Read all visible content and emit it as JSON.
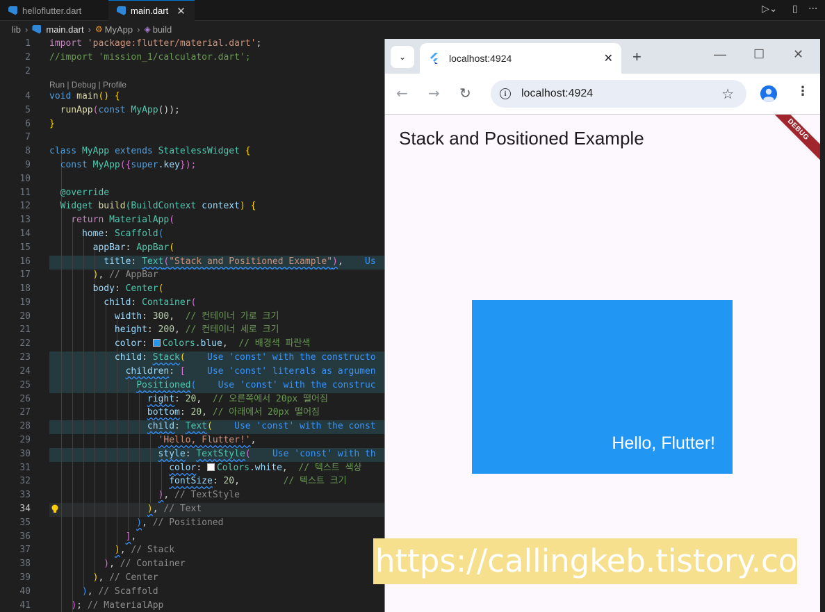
{
  "editor_tabs": [
    {
      "label": "helloflutter.dart",
      "active": false
    },
    {
      "label": "main.dart",
      "active": true
    }
  ],
  "breadcrumb": {
    "folder": "lib",
    "file": "main.dart",
    "class": "MyApp",
    "method": "build"
  },
  "codelens": "Run | Debug | Profile",
  "current_line": 34,
  "code": {
    "l1_kw": "import",
    "l1_str": "'package:flutter/material.dart'",
    "l1_end": ";",
    "l2": "//import 'mission_1/calculator.dart';",
    "l4_void": "void",
    "l4_main": "main",
    "l4_rest": "() {",
    "l5_fn": "runApp",
    "l5_const": "const",
    "l5_cls": "MyApp",
    "l5_rest": "());",
    "l6": "}",
    "l8_class": "class",
    "l8_name": "MyApp",
    "l8_ext": "extends",
    "l8_base": "StatelessWidget",
    "l8_brace": "{",
    "l9_const": "const",
    "l9_name": "MyApp",
    "l9_open": "({",
    "l9_super": "super",
    "l9_key": ".key",
    "l9_close": "});",
    "l11": "@override",
    "l12_type": "Widget",
    "l12_fn": "build",
    "l12_arg": "(BuildContext",
    "l12_ctx": "context",
    "l12_rest": ") {",
    "l13_ret": "return",
    "l13_cls": "MaterialApp",
    "l14_home": "home",
    "l14_cls": "Scaffold",
    "l15_prop": "appBar",
    "l15_cls": "AppBar",
    "l16_prop": "title",
    "l16_cls": "Text",
    "l16_str": "\"Stack and Positioned Example\"",
    "l16_hint": "Us",
    "l17_close": "),",
    "l17_cmt": "// AppBar",
    "l18_prop": "body",
    "l18_cls": "Center",
    "l19_prop": "child",
    "l19_cls": "Container",
    "l20_prop": "width",
    "l20_val": "300",
    "l20_cmt": "// 컨테이너 가로 크기",
    "l21_prop": "height",
    "l21_val": "200",
    "l21_cmt": "// 컨테이너 세로 크기",
    "l22_prop": "color",
    "l22_cls": "Colors",
    "l22_val": ".blue",
    "l22_cmt": "// 배경색 파란색",
    "l23_prop": "child",
    "l23_cls": "Stack",
    "l23_hint": "Use 'const' with the constructo",
    "l24_prop": "children",
    "l24_hint": "Use 'const' literals as argumen",
    "l25_cls": "Positioned",
    "l25_hint": "Use 'const' with the construc",
    "l26_prop": "right",
    "l26_val": "20",
    "l26_cmt": "// 오른쪽에서 20px 떨어짐",
    "l27_prop": "bottom",
    "l27_val": "20",
    "l27_cmt": "// 아래에서 20px 떨어짐",
    "l28_prop": "child",
    "l28_cls": "Text",
    "l28_hint": "Use 'const' with the const",
    "l29_str": "'Hello, Flutter!'",
    "l30_prop": "style",
    "l30_cls": "TextStyle",
    "l30_hint": "Use 'const' with th",
    "l31_prop": "color",
    "l31_cls": "Colors",
    "l31_val": ".white",
    "l31_cmt": "// 텍스트 색상",
    "l32_prop": "fontSize",
    "l32_val": "20",
    "l32_cmt": "// 텍스트 크기",
    "l33_cmt": "// TextStyle",
    "l34_cmt": "// Text",
    "l35_cmt": "// Positioned",
    "l37_cmt": "// Stack",
    "l38_cmt": "// Container",
    "l39_cmt": "// Center",
    "l40_cmt": "// Scaffold",
    "l41_cmt": "// MaterialApp"
  },
  "browser": {
    "tab_title": "localhost:4924",
    "url": "localhost:4924",
    "new_tab": "+",
    "close": "✕"
  },
  "app": {
    "title": "Stack and Positioned Example",
    "debug_banner": "DEBUG",
    "box_text": "Hello, Flutter!",
    "box_color": "#2196f3"
  },
  "watermark": "https://callingkeb.tistory.com"
}
